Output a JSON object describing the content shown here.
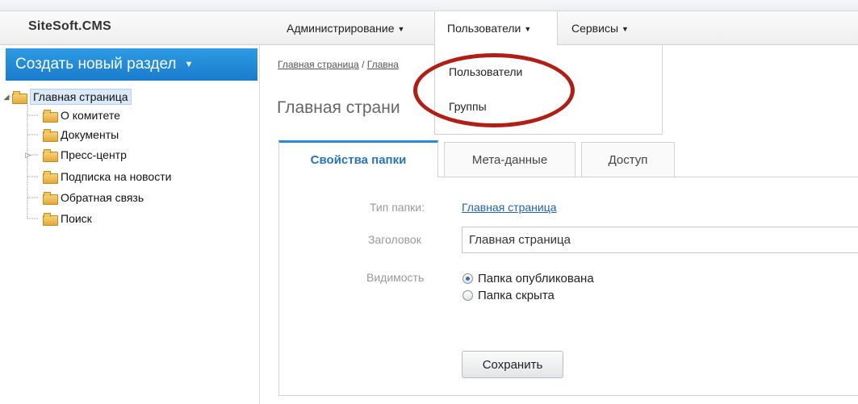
{
  "app": {
    "brand": "SiteSoft.CMS"
  },
  "topnav": {
    "admin": "Администрирование",
    "users": "Пользователи",
    "services": "Сервисы"
  },
  "sidebar": {
    "create_button": "Создать новый раздел",
    "tree": {
      "root": "Главная страница",
      "children": [
        "О комитете",
        "Документы",
        "Пресс-центр",
        "Подписка на новости",
        "Обратная связь",
        "Поиск"
      ]
    }
  },
  "users_menu": {
    "items": [
      "Пользователи",
      "Группы"
    ]
  },
  "main": {
    "breadcrumb": [
      "Главная страница",
      "Главна"
    ],
    "breadcrumb_separator": " / ",
    "title": "Главная страни",
    "tabs": [
      "Свойства папки",
      "Мета-данные",
      "Доступ"
    ],
    "form": {
      "type_label": "Тип папки:",
      "type_value": "Главная страница",
      "title_label": "Заголовок",
      "title_value": "Главная страница",
      "visibility_label": "Видимость",
      "visibility_options": [
        "Папка опубликована",
        "Папка скрыта"
      ],
      "visibility_selected": "Папка опубликована",
      "save_label": "Сохранить"
    }
  },
  "colors": {
    "accent": "#1a7ccc",
    "annotation": "#b01e16",
    "link": "#2563b5"
  }
}
